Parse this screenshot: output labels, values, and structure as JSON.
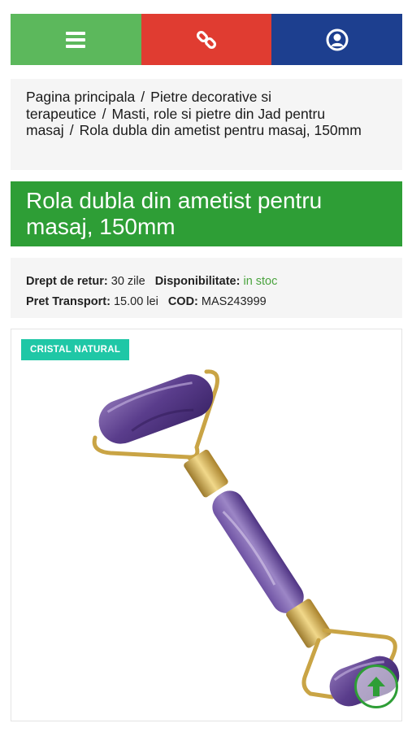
{
  "nav": {
    "menu_icon": "hamburger-menu-icon",
    "link_icon": "chain-link-icon",
    "user_icon": "user-account-icon",
    "colors": {
      "menu": "#5cb85c",
      "link": "#e03c31",
      "user": "#1d3f8f"
    }
  },
  "breadcrumb": {
    "items": [
      "Pagina principala",
      "Pietre decorative si terapeutice",
      "Masti, role si pietre din Jad pentru masaj",
      "Rola dubla din ametist pentru masaj, 150mm"
    ],
    "separator": "/"
  },
  "product": {
    "title": "Rola dubla din ametist pentru masaj, 150mm",
    "return_label": "Drept de retur:",
    "return_value": "30 zile",
    "availability_label": "Disponibilitate:",
    "availability_value": "in stoc",
    "shipping_label": "Pret Transport:",
    "shipping_value": "15.00 lei",
    "code_label": "COD:",
    "code_value": "MAS243999",
    "badge": "CRISTAL NATURAL",
    "image_icon": "amethyst-face-roller-image"
  },
  "scroll_top": {
    "icon": "arrow-up-icon",
    "color": "#2e9e36"
  }
}
